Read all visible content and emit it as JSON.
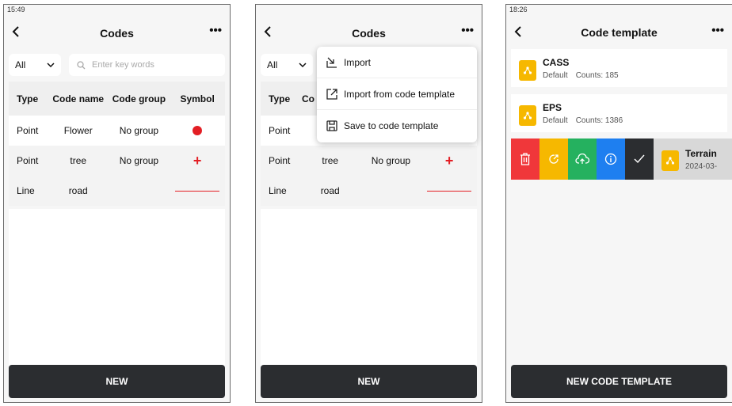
{
  "colors": {
    "accent_red": "#e31e24",
    "button_dark": "#2b2d30",
    "template_yellow": "#f6b800"
  },
  "screen1": {
    "time": "15:49",
    "title": "Codes",
    "back_icon": "chevron-left-icon",
    "more_icon": "more-horizontal-icon",
    "filter_value": "All",
    "search_placeholder": "Enter key words",
    "columns": [
      "Type",
      "Code name",
      "Code group",
      "Symbol"
    ],
    "rows": [
      {
        "type": "Point",
        "name": "Flower",
        "group": "No group",
        "symbol": "red-dot"
      },
      {
        "type": "Point",
        "name": "tree",
        "group": "No group",
        "symbol": "red-plus"
      },
      {
        "type": "Line",
        "name": "road",
        "group": "",
        "symbol": "red-line"
      }
    ],
    "new_button": "NEW"
  },
  "screen2": {
    "title": "Codes",
    "filter_value": "All",
    "columns": [
      "Type",
      "Co"
    ],
    "rows": [
      {
        "type": "Point",
        "name": "",
        "group": ""
      },
      {
        "type": "Point",
        "name": "tree",
        "group": "No group",
        "symbol": "red-plus"
      },
      {
        "type": "Line",
        "name": "road",
        "group": "",
        "symbol": "red-line"
      }
    ],
    "menu": [
      {
        "label": "Import",
        "icon": "import-icon"
      },
      {
        "label": "Import from code template",
        "icon": "export-icon"
      },
      {
        "label": "Save to code template",
        "icon": "save-icon"
      }
    ],
    "new_button": "NEW"
  },
  "screen3": {
    "time": "18:26",
    "title": "Code template",
    "templates": [
      {
        "name": "CASS",
        "tag": "Default",
        "counts": "Counts: 185"
      },
      {
        "name": "EPS",
        "tag": "Default",
        "counts": "Counts: 1386"
      }
    ],
    "swipe_actions": [
      {
        "icon": "trash-icon",
        "color": "#f0373a"
      },
      {
        "icon": "share-icon",
        "color": "#f6b800"
      },
      {
        "icon": "cloud-upload-icon",
        "color": "#25b15f"
      },
      {
        "icon": "info-icon",
        "color": "#1e7ff0"
      },
      {
        "icon": "check-icon",
        "color": "#2b2d30"
      }
    ],
    "swiped_template": {
      "name": "Terrain",
      "date": "2024-03-"
    },
    "new_button": "NEW CODE TEMPLATE"
  }
}
